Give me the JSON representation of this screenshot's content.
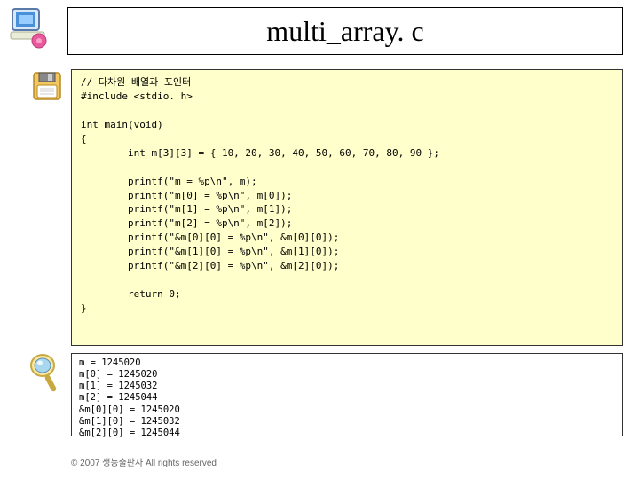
{
  "title": "multi_array. c",
  "code": "// 다차원 배열과 포인터\n#include <stdio. h>\n\nint main(void)\n{\n        int m[3][3] = { 10, 20, 30, 40, 50, 60, 70, 80, 90 };\n\n        printf(\"m = %p\\n\", m);\n        printf(\"m[0] = %p\\n\", m[0]);\n        printf(\"m[1] = %p\\n\", m[1]);\n        printf(\"m[2] = %p\\n\", m[2]);\n        printf(\"&m[0][0] = %p\\n\", &m[0][0]);\n        printf(\"&m[1][0] = %p\\n\", &m[1][0]);\n        printf(\"&m[2][0] = %p\\n\", &m[2][0]);\n\n        return 0;\n}",
  "output": "m = 1245020\nm[0] = 1245020\nm[1] = 1245032\nm[2] = 1245044\n&m[0][0] = 1245020\n&m[1][0] = 1245032\n&m[2][0] = 1245044",
  "footer": "© 2007 생능출판사  All rights reserved"
}
